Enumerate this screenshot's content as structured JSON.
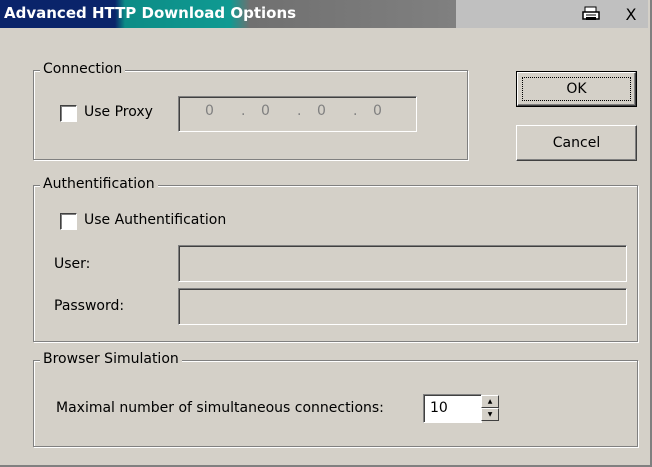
{
  "window": {
    "title": "Advanced HTTP Download Options",
    "buttons": {
      "print_icon": "printer-icon",
      "close_label": "X"
    }
  },
  "connection": {
    "group_label": "Connection",
    "use_proxy_label": "Use Proxy",
    "use_proxy_checked": false,
    "proxy_ip": [
      "0",
      "0",
      "0",
      "0"
    ],
    "ip_separator": "."
  },
  "authentication": {
    "group_label": "Authentification",
    "use_auth_label": "Use Authentification",
    "use_auth_checked": false,
    "user_label": "User:",
    "user_value": "",
    "password_label": "Password:",
    "password_value": ""
  },
  "browser_simulation": {
    "group_label": "Browser Simulation",
    "max_connections_label": "Maximal number of simultaneous connections:",
    "max_connections_value": "10"
  },
  "actions": {
    "ok_label": "OK",
    "cancel_label": "Cancel"
  }
}
